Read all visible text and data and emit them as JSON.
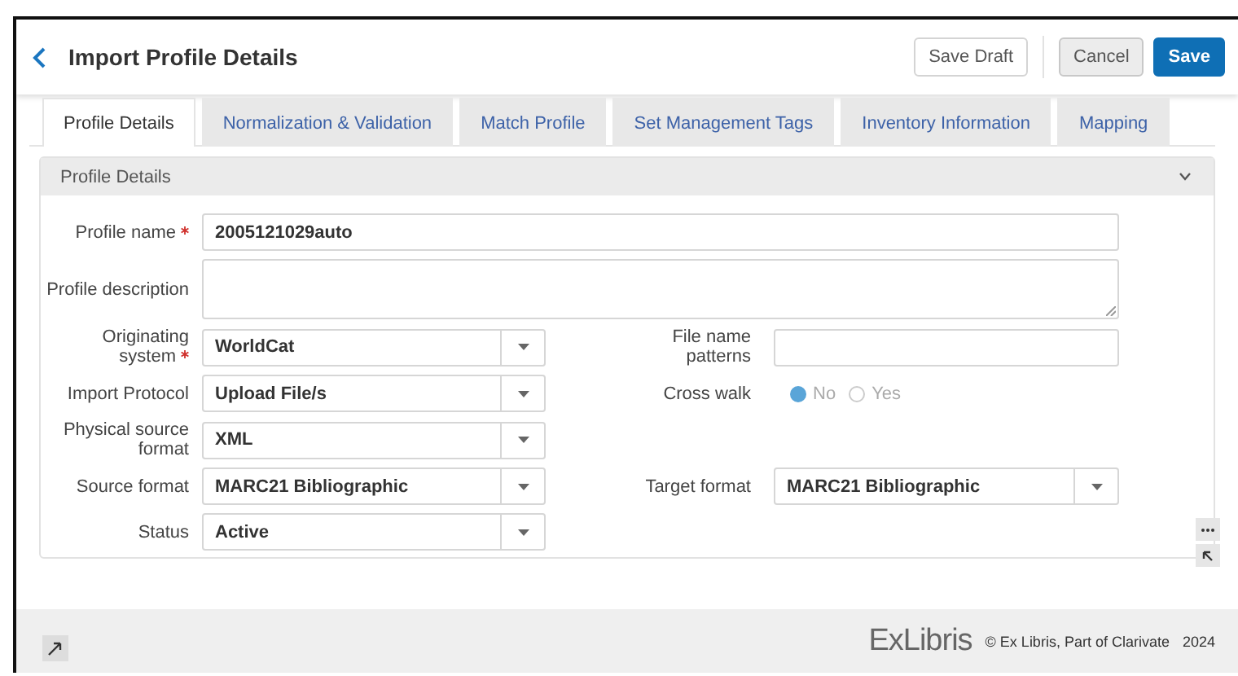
{
  "header": {
    "title": "Import Profile Details",
    "buttons": [
      {
        "label": "Save Draft",
        "kind": "outline"
      },
      {
        "label": "Cancel",
        "kind": "muted"
      },
      {
        "label": "Save",
        "kind": "primary"
      }
    ]
  },
  "tabs": [
    {
      "label": "Profile Details",
      "selected": true
    },
    {
      "label": "Normalization & Validation",
      "selected": false
    },
    {
      "label": "Match Profile",
      "selected": false
    },
    {
      "label": "Set Management Tags",
      "selected": false
    },
    {
      "label": "Inventory Information",
      "selected": false
    },
    {
      "label": "Mapping",
      "selected": false
    }
  ],
  "section": {
    "title": "Profile Details",
    "expanded": true,
    "rows": [
      {
        "fields": [
          {
            "label": "Profile name",
            "required": true,
            "kind": "widetext",
            "value": "2005121029auto"
          }
        ]
      },
      {
        "fields": [
          {
            "label": "Profile description",
            "required": false,
            "kind": "textarea"
          }
        ]
      },
      {
        "fields": [
          {
            "label": "Originating system",
            "required": true,
            "kind": "select",
            "value": "WorldCat"
          },
          {
            "label": "File name patterns",
            "required": false,
            "kind": "text"
          }
        ]
      },
      {
        "fields": [
          {
            "label": "Import Protocol",
            "required": false,
            "kind": "select",
            "value": "Upload File/s"
          },
          {
            "label": "Cross walk",
            "required": false,
            "kind": "radio",
            "options": [
              {
                "label": "No",
                "selected": true
              },
              {
                "label": "Yes",
                "selected": false
              }
            ]
          }
        ]
      },
      {
        "fields": [
          {
            "label": "Physical source format",
            "required": false,
            "kind": "select",
            "value": "XML"
          }
        ]
      },
      {
        "fields": [
          {
            "label": "Source format",
            "required": false,
            "kind": "select",
            "value": "MARC21 Bibliographic"
          },
          {
            "label": "Target format",
            "required": false,
            "kind": "select",
            "value": "MARC21 Bibliographic"
          }
        ]
      },
      {
        "fields": [
          {
            "label": "Status",
            "required": false,
            "kind": "select",
            "value": "Active"
          }
        ]
      }
    ]
  },
  "footer": {
    "logo": "ExLibris",
    "copyright": "© Ex Libris, Part of Clarivate",
    "year": "2024"
  }
}
